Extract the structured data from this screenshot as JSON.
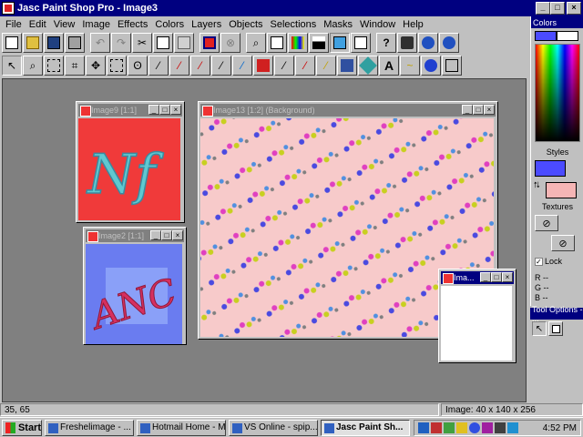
{
  "window": {
    "title": "Jasc Paint Shop Pro - Image3"
  },
  "menu": [
    "File",
    "Edit",
    "View",
    "Image",
    "Effects",
    "Colors",
    "Layers",
    "Objects",
    "Selections",
    "Masks",
    "Window",
    "Help"
  ],
  "documents": {
    "image9": {
      "title": "Image9 [1:1]"
    },
    "image2": {
      "title": "Image2 [1:1]"
    },
    "image13": {
      "title": "Image13 [1:2] (Background)"
    },
    "image3": {
      "title": "Ima..."
    },
    "image9_art": "Nf",
    "image2_art": "ANC"
  },
  "palette": {
    "title": "Colors",
    "styles_label": "Styles",
    "textures_label": "Textures",
    "lock_label": "Lock",
    "rgb": [
      "R --",
      "G --",
      "B --"
    ],
    "foreground_color": "#4b4bff",
    "background_color": "#f5b5b5"
  },
  "tool_options": {
    "title": "Tool Options - ..."
  },
  "status": {
    "coords": "35, 65",
    "image_info": "Image: 40 x 140 x 256"
  },
  "taskbar": {
    "start": "Start",
    "tasks": [
      "Freshelimage - ...",
      "Hotmail Home - M...",
      "VS Online - spip...",
      "Jasc Paint Sh..."
    ],
    "clock": "4:52 PM"
  },
  "colors": {
    "titlebar": "#000080",
    "face": "#c0c0c0",
    "workspace": "#808080",
    "canvas_bg": "#f7caca"
  }
}
